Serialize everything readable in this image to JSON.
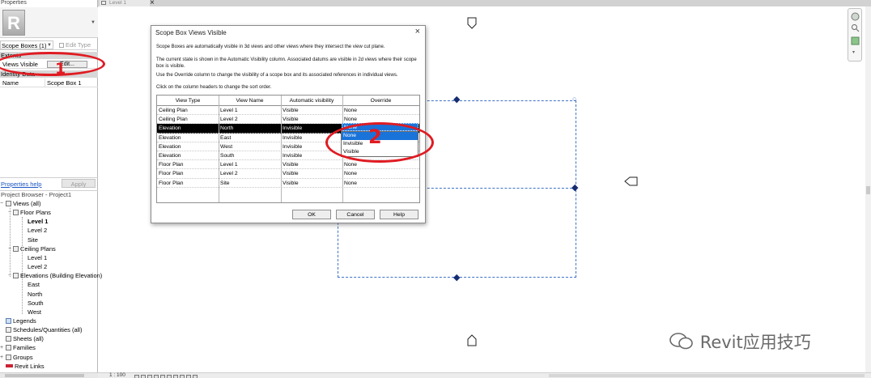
{
  "properties_panel": {
    "title": "Properties",
    "type_selector": "Scope Boxes (1)",
    "edit_type_label": "Edit Type",
    "groups": [
      {
        "name": "Extents",
        "rows": [
          {
            "key": "Views Visible",
            "button": "Edit..."
          }
        ]
      },
      {
        "name": "Identity Data",
        "rows": [
          {
            "key": "Name",
            "value": "Scope Box 1"
          }
        ]
      }
    ],
    "help_link": "Properties help",
    "apply_label": "Apply"
  },
  "project_browser": {
    "title": "Project Browser - Project1",
    "tree": [
      {
        "label": "Views (all)",
        "level": 0,
        "toggle": "−",
        "bold": false
      },
      {
        "label": "Floor Plans",
        "level": 1,
        "toggle": "−",
        "bold": false
      },
      {
        "label": "Level 1",
        "level": 2,
        "bold": true
      },
      {
        "label": "Level 2",
        "level": 2,
        "bold": false
      },
      {
        "label": "Site",
        "level": 2,
        "bold": false
      },
      {
        "label": "Ceiling Plans",
        "level": 1,
        "toggle": "−",
        "bold": false
      },
      {
        "label": "Level 1",
        "level": 2,
        "bold": false
      },
      {
        "label": "Level 2",
        "level": 2,
        "bold": false
      },
      {
        "label": "Elevations (Building Elevation)",
        "level": 1,
        "toggle": "−",
        "bold": false
      },
      {
        "label": "East",
        "level": 2,
        "bold": false
      },
      {
        "label": "North",
        "level": 2,
        "bold": false
      },
      {
        "label": "South",
        "level": 2,
        "bold": false
      },
      {
        "label": "West",
        "level": 2,
        "bold": false
      },
      {
        "label": "Legends",
        "level": 0,
        "bold": false
      },
      {
        "label": "Schedules/Quantities (all)",
        "level": 0,
        "bold": false
      },
      {
        "label": "Sheets (all)",
        "level": 0,
        "bold": false
      },
      {
        "label": "Families",
        "level": 0,
        "toggle": "+",
        "bold": false
      },
      {
        "label": "Groups",
        "level": 0,
        "toggle": "+",
        "bold": false
      },
      {
        "label": "Revit Links",
        "level": 0,
        "bold": false
      }
    ]
  },
  "view_tab": {
    "label": "Level 1",
    "close_glyph": "×"
  },
  "dialog": {
    "title": "Scope Box Views Visible",
    "close_glyph": "×",
    "paragraphs": [
      "Scope Boxes are automatically visible in 3d views and other views where they intersect the view cut plane.",
      "The current state is shown in the Automatic Visibility column. Associated datums are visible in 2d views where their scope box is visible.",
      "Use the Override column to change the visibility of a scope box and its associated references in individual views.",
      "Click on the column headers to change the sort order."
    ],
    "columns": [
      "View Type",
      "View Name",
      "Automatic visibility",
      "Override"
    ],
    "rows": [
      {
        "type": "Ceiling Plan",
        "name": "Level 1",
        "auto": "Visible",
        "override": "None",
        "selected": false
      },
      {
        "type": "Ceiling Plan",
        "name": "Level 2",
        "auto": "Visible",
        "override": "None",
        "selected": false
      },
      {
        "type": "Elevation",
        "name": "North",
        "auto": "Invisible",
        "override": "None",
        "selected": true
      },
      {
        "type": "Elevation",
        "name": "East",
        "auto": "Invisible",
        "override": "",
        "selected": false
      },
      {
        "type": "Elevation",
        "name": "West",
        "auto": "Invisible",
        "override": "",
        "selected": false
      },
      {
        "type": "Elevation",
        "name": "South",
        "auto": "Invisible",
        "override": "",
        "selected": false
      },
      {
        "type": "Floor Plan",
        "name": "Level 1",
        "auto": "Visible",
        "override": "None",
        "selected": false
      },
      {
        "type": "Floor Plan",
        "name": "Level 2",
        "auto": "Visible",
        "override": "None",
        "selected": false
      },
      {
        "type": "Floor Plan",
        "name": "Site",
        "auto": "Visible",
        "override": "None",
        "selected": false
      }
    ],
    "dropdown": {
      "current": "None",
      "options": [
        "None",
        "Invisible",
        "Visible"
      ],
      "highlighted": 0
    },
    "buttons": {
      "ok": "OK",
      "cancel": "Cancel",
      "help": "Help"
    }
  },
  "annotations": {
    "step1": "1",
    "step2": "2",
    "color": "#e01b22"
  },
  "status_bar": {
    "scale": "1 : 100"
  },
  "watermark": "Revit应用技巧",
  "colors": {
    "scope_box": "#3f73c7",
    "selection_highlight": "#1a73d9",
    "link": "#1a56c4"
  }
}
